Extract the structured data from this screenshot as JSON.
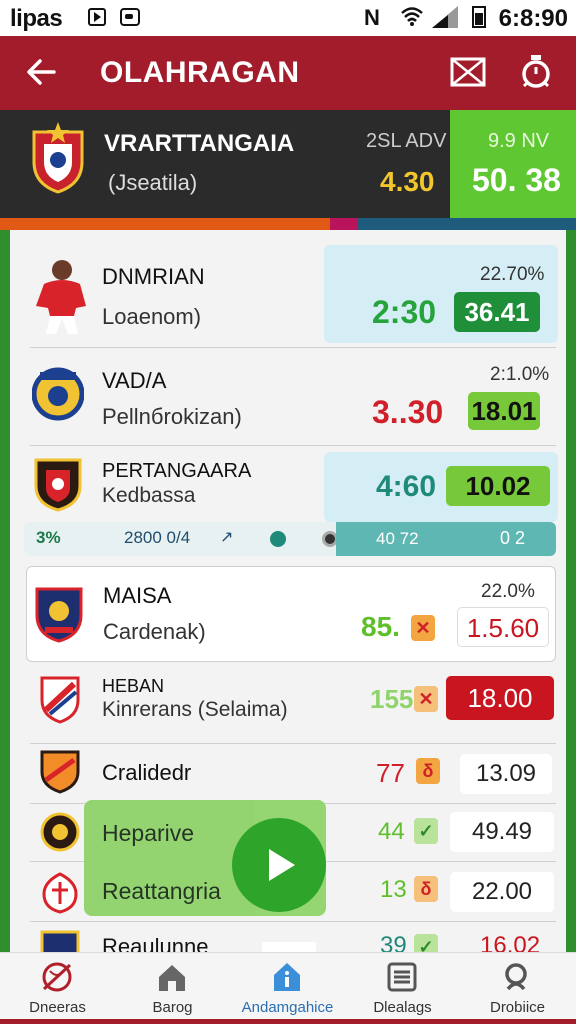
{
  "status_bar": {
    "left_text": "lipas",
    "nfc_text": "N",
    "time": "6:8:90"
  },
  "app_bar": {
    "title": "OLAHRAGAN"
  },
  "match_header": {
    "team": "VRARTTANGAIA",
    "subtitle": "(Jseatila)",
    "label_left": "2SL ADV",
    "value_left": "4.30",
    "label_right": "9.9 NV",
    "value_right": "50. 38"
  },
  "rows": [
    {
      "name": "DNMRIAN",
      "sub": "Loaenom)",
      "pct": "22.70%",
      "score": "2:30",
      "odds": "36.41"
    },
    {
      "name": "VAD/A",
      "sub": "Pellnбrokizan)",
      "pct": "2:1.0%",
      "score": "3..30",
      "odds": "18.01"
    },
    {
      "name": "PERTANGAARA",
      "sub": "Kedbassa",
      "score": "4:60",
      "odds": "10.02"
    },
    {
      "name": "MAISA",
      "sub": "Cardenak)",
      "pct": "22.0%",
      "score": "85.",
      "odds": "1.5.60"
    },
    {
      "name": "HEBAN",
      "sub": "Kinrerans (Selaima)",
      "score": "155",
      "odds": "18.00"
    },
    {
      "name": "Cralidedr",
      "score": "77",
      "odds": "13.09"
    },
    {
      "name": "Heparive",
      "score": "44",
      "odds": "49.49"
    },
    {
      "name": "Reattangria",
      "score": "13",
      "odds": "22.00"
    },
    {
      "name": "Reaulunne",
      "score": "39",
      "odds": "16.02"
    }
  ],
  "progress": {
    "left": "3%",
    "mid": "2800 0/4",
    "arrow": "↗",
    "value_a": "40 72",
    "value_b": "0   2"
  },
  "overlay": {
    "line1": "Heparive",
    "line2": "Reattangria"
  },
  "bottom_nav": [
    {
      "label": "Dneeras"
    },
    {
      "label": "Barog"
    },
    {
      "label": "Andamgahice"
    },
    {
      "label": "Dlealags"
    },
    {
      "label": "Drobiice"
    }
  ],
  "colors": {
    "brand_red": "#a31c2c",
    "accent_green": "#5ec731",
    "odds_dark_green": "#1f8f3a",
    "odds_red": "#c9151f"
  }
}
